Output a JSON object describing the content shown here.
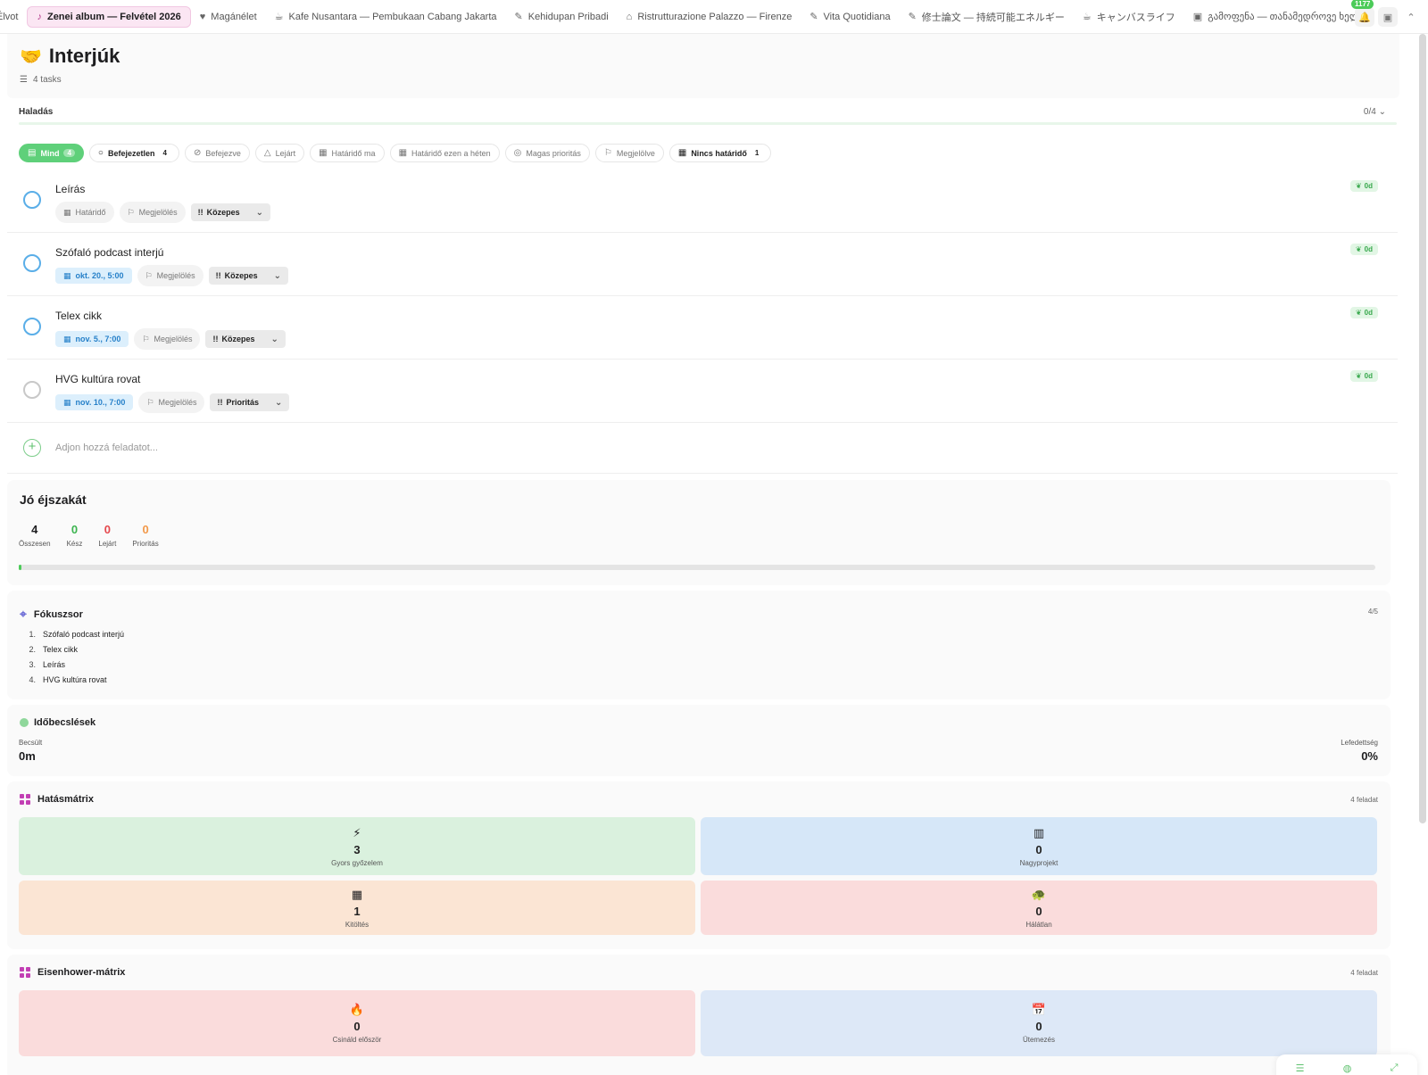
{
  "tabs": [
    {
      "label": "Élvot",
      "icon": "",
      "active": false
    },
    {
      "label": "Zenei album — Felvétel 2026",
      "icon": "♪",
      "active": true
    },
    {
      "label": "Magánélet",
      "icon": "♥",
      "active": false
    },
    {
      "label": "Kafe Nusantara — Pembukaan Cabang Jakarta",
      "icon": "☕",
      "active": false
    },
    {
      "label": "Kehidupan Pribadi",
      "icon": "✎",
      "active": false
    },
    {
      "label": "Ristrutturazione Palazzo — Firenze",
      "icon": "⌂",
      "active": false
    },
    {
      "label": "Vita Quotidiana",
      "icon": "✎",
      "active": false
    },
    {
      "label": "修士論文 — 持続可能エネルギー",
      "icon": "✎",
      "active": false
    },
    {
      "label": "キャンバスライフ",
      "icon": "☕",
      "active": false
    },
    {
      "label": "გამოფენა — თანამედროვე ხელოვნება",
      "icon": "▣",
      "active": false
    }
  ],
  "notifications": {
    "count": "1177"
  },
  "header": {
    "title": "Interjúk",
    "icon": "🤝",
    "subtitle": "4 tasks"
  },
  "progress": {
    "label": "Haladás",
    "count": "0/4",
    "fraction": 0
  },
  "filters": [
    {
      "label": "Mind",
      "count": "4",
      "icon": "▤",
      "active": true
    },
    {
      "label": "Befejezetlen",
      "count": "4",
      "icon": "○",
      "bold": true
    },
    {
      "label": "Befejezve",
      "icon": "⊘"
    },
    {
      "label": "Lejárt",
      "icon": "△"
    },
    {
      "label": "Határidő ma",
      "icon": "▦"
    },
    {
      "label": "Határidő ezen a héten",
      "icon": "▦"
    },
    {
      "label": "Magas prioritás",
      "icon": "◎"
    },
    {
      "label": "Megjelölve",
      "icon": "⚐"
    },
    {
      "label": "Nincs határidő",
      "count": "1",
      "icon": "▦",
      "bold": true
    }
  ],
  "tasks": [
    {
      "title": "Leírás",
      "date": "Határidő",
      "date_set": false,
      "flag": "Megjelölés",
      "priority": "Közepes",
      "time": "0d",
      "check_color": "blue"
    },
    {
      "title": "Szófaló podcast interjú",
      "date": "okt. 20., 5:00",
      "date_set": true,
      "flag": "Megjelölés",
      "priority": "Közepes",
      "time": "0d",
      "check_color": "blue"
    },
    {
      "title": "Telex cikk",
      "date": "nov. 5., 7:00",
      "date_set": true,
      "flag": "Megjelölés",
      "priority": "Közepes",
      "time": "0d",
      "check_color": "blue"
    },
    {
      "title": "HVG kultúra rovat",
      "date": "nov. 10., 7:00",
      "date_set": true,
      "flag": "Megjelölés",
      "priority": "Prioritás",
      "time": "0d",
      "check_color": "grey"
    }
  ],
  "add_task": {
    "placeholder": "Adjon hozzá feladatot..."
  },
  "night": {
    "title": "Jó éjszakát",
    "stats": [
      {
        "value": "4",
        "label": "Összesen",
        "color": "#1d1d1f"
      },
      {
        "value": "0",
        "label": "Kész",
        "color": "#3cb44f"
      },
      {
        "value": "0",
        "label": "Lejárt",
        "color": "#e5484d"
      },
      {
        "value": "0",
        "label": "Prioritás",
        "color": "#f2994a"
      }
    ]
  },
  "focus": {
    "title": "Fókuszsor",
    "count": "4/5",
    "items": [
      "Szófaló podcast interjú",
      "Telex cikk",
      "Leírás",
      "HVG kultúra rovat"
    ]
  },
  "estimates": {
    "title": "Időbecslések",
    "estimated_label": "Becsült",
    "estimated_value": "0m",
    "coverage_label": "Lefedettség",
    "coverage_value": "0%"
  },
  "impact": {
    "title": "Hatásmátrix",
    "count": "4 feladat",
    "cells": [
      {
        "icon": "⚡",
        "value": "3",
        "label": "Gyors győzelem",
        "bg": "#daf1de"
      },
      {
        "icon": "▥",
        "value": "0",
        "label": "Nagyprojekt",
        "bg": "#d6e7f8"
      },
      {
        "icon": "▦",
        "value": "1",
        "label": "Kitöltés",
        "bg": "#fbe5d4"
      },
      {
        "icon": "🐢",
        "value": "0",
        "label": "Hálátlan",
        "bg": "#fadcdc"
      }
    ]
  },
  "eisenhower": {
    "title": "Eisenhower-mátrix",
    "count": "4 feladat",
    "cells": [
      {
        "icon": "🔥",
        "value": "0",
        "label": "Csináld először",
        "bg": "#fadcdc"
      },
      {
        "icon": "📅",
        "value": "0",
        "label": "Ütemezés",
        "bg": "#dde8f7"
      }
    ]
  }
}
